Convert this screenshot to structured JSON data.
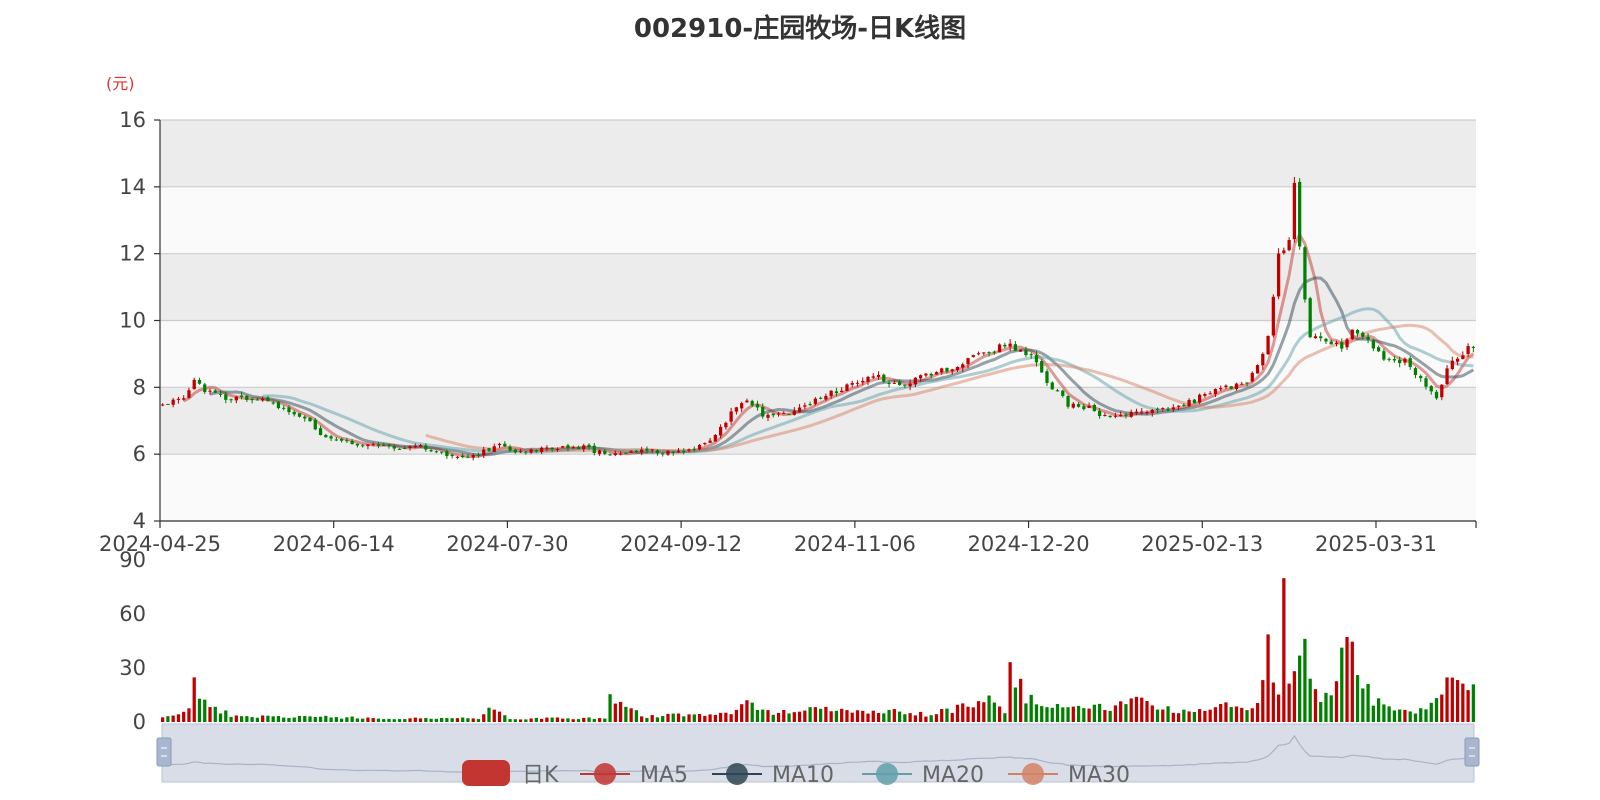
{
  "chart_data": {
    "type": "candlestick",
    "title": "002910-庄园牧场-日K线图",
    "unit": "(元)",
    "price_axis": {
      "ylim": [
        4,
        16
      ],
      "ticks": [
        "4",
        "6",
        "8",
        "10",
        "12",
        "14",
        "16"
      ]
    },
    "volume_axis": {
      "ylim": [
        0,
        90
      ],
      "ticks": [
        "0",
        "30",
        "60",
        "90"
      ]
    },
    "x_tick_labels": [
      "2024-04-25",
      "2024-06-14",
      "2024-07-30",
      "2024-09-12",
      "2024-11-06",
      "2024-12-20",
      "2025-02-13",
      "2025-03-31"
    ],
    "x_tick_index": [
      0,
      33,
      66,
      99,
      132,
      165,
      198,
      231
    ],
    "n_bars": 250,
    "anchors": [
      [
        0,
        7.5
      ],
      [
        4,
        7.7
      ],
      [
        6,
        8.2
      ],
      [
        8,
        7.9
      ],
      [
        12,
        7.7
      ],
      [
        16,
        7.7
      ],
      [
        20,
        7.6
      ],
      [
        24,
        7.3
      ],
      [
        28,
        7.0
      ],
      [
        30,
        6.6
      ],
      [
        32,
        6.4
      ],
      [
        38,
        6.3
      ],
      [
        44,
        6.2
      ],
      [
        48,
        6.25
      ],
      [
        52,
        6.1
      ],
      [
        56,
        5.9
      ],
      [
        60,
        6.0
      ],
      [
        64,
        6.3
      ],
      [
        66,
        6.1
      ],
      [
        70,
        6.1
      ],
      [
        74,
        6.2
      ],
      [
        80,
        6.2
      ],
      [
        84,
        6.0
      ],
      [
        88,
        6.05
      ],
      [
        92,
        6.1
      ],
      [
        96,
        6.05
      ],
      [
        99,
        6.1
      ],
      [
        104,
        6.4
      ],
      [
        108,
        7.2
      ],
      [
        111,
        7.6
      ],
      [
        114,
        7.2
      ],
      [
        118,
        7.2
      ],
      [
        124,
        7.6
      ],
      [
        128,
        7.9
      ],
      [
        132,
        8.2
      ],
      [
        136,
        8.3
      ],
      [
        140,
        8.1
      ],
      [
        144,
        8.3
      ],
      [
        150,
        8.6
      ],
      [
        156,
        9.0
      ],
      [
        160,
        9.3
      ],
      [
        163,
        9.1
      ],
      [
        165,
        8.9
      ],
      [
        168,
        8.2
      ],
      [
        172,
        7.5
      ],
      [
        176,
        7.4
      ],
      [
        179,
        7.1
      ],
      [
        182,
        7.2
      ],
      [
        186,
        7.2
      ],
      [
        192,
        7.35
      ],
      [
        196,
        7.6
      ],
      [
        200,
        8.0
      ],
      [
        203,
        8.0
      ],
      [
        206,
        8.2
      ],
      [
        208,
        8.6
      ],
      [
        210,
        9.6
      ],
      [
        212,
        11.9
      ],
      [
        214,
        12.3
      ],
      [
        215,
        14.0
      ],
      [
        216,
        12.2
      ],
      [
        217,
        10.6
      ],
      [
        218,
        9.6
      ],
      [
        222,
        9.3
      ],
      [
        224,
        9.2
      ],
      [
        226,
        9.7
      ],
      [
        228,
        9.5
      ],
      [
        230,
        9.2
      ],
      [
        232,
        8.8
      ],
      [
        236,
        8.8
      ],
      [
        238,
        8.4
      ],
      [
        240,
        8.1
      ],
      [
        242,
        7.7
      ],
      [
        244,
        8.6
      ],
      [
        246,
        8.8
      ],
      [
        248,
        9.2
      ],
      [
        250,
        9.3
      ],
      [
        253,
        10.2
      ]
    ],
    "volume_anchors": [
      [
        0,
        3
      ],
      [
        5,
        6
      ],
      [
        6,
        20
      ],
      [
        8,
        15
      ],
      [
        10,
        7
      ],
      [
        14,
        3
      ],
      [
        30,
        3
      ],
      [
        40,
        2
      ],
      [
        60,
        2
      ],
      [
        62,
        8
      ],
      [
        64,
        5
      ],
      [
        66,
        2
      ],
      [
        84,
        2
      ],
      [
        85,
        14
      ],
      [
        88,
        8
      ],
      [
        92,
        3
      ],
      [
        108,
        5
      ],
      [
        110,
        12
      ],
      [
        114,
        6
      ],
      [
        120,
        5
      ],
      [
        124,
        8
      ],
      [
        130,
        7
      ],
      [
        140,
        6
      ],
      [
        145,
        4
      ],
      [
        155,
        10
      ],
      [
        158,
        12
      ],
      [
        160,
        6
      ],
      [
        161,
        29
      ],
      [
        164,
        14
      ],
      [
        168,
        8
      ],
      [
        175,
        10
      ],
      [
        180,
        7
      ],
      [
        184,
        12
      ],
      [
        188,
        9
      ],
      [
        195,
        5
      ],
      [
        200,
        8
      ],
      [
        205,
        10
      ],
      [
        207,
        6
      ],
      [
        208,
        13
      ],
      [
        210,
        42
      ],
      [
        212,
        15
      ],
      [
        213,
        66
      ],
      [
        214,
        30
      ],
      [
        216,
        42
      ],
      [
        218,
        30
      ],
      [
        220,
        15
      ],
      [
        222,
        14
      ],
      [
        224,
        35
      ],
      [
        225,
        44
      ],
      [
        227,
        25
      ],
      [
        230,
        12
      ],
      [
        234,
        8
      ],
      [
        236,
        6
      ],
      [
        240,
        6
      ],
      [
        242,
        15
      ],
      [
        244,
        22
      ],
      [
        248,
        17
      ],
      [
        250,
        20
      ],
      [
        253,
        32
      ]
    ],
    "series": [
      {
        "name": "日K",
        "color": "#c23531"
      },
      {
        "name": "MA5",
        "color": "#c23531"
      },
      {
        "name": "MA10",
        "color": "#2f4554"
      },
      {
        "name": "MA20",
        "color": "#61a0a8"
      },
      {
        "name": "MA30",
        "color": "#d48265"
      }
    ],
    "colors": {
      "up": "#c00000",
      "down": "#008000",
      "band_gray": "#ececec",
      "band_white": "#fafafa",
      "grid": "#cccccc"
    }
  }
}
